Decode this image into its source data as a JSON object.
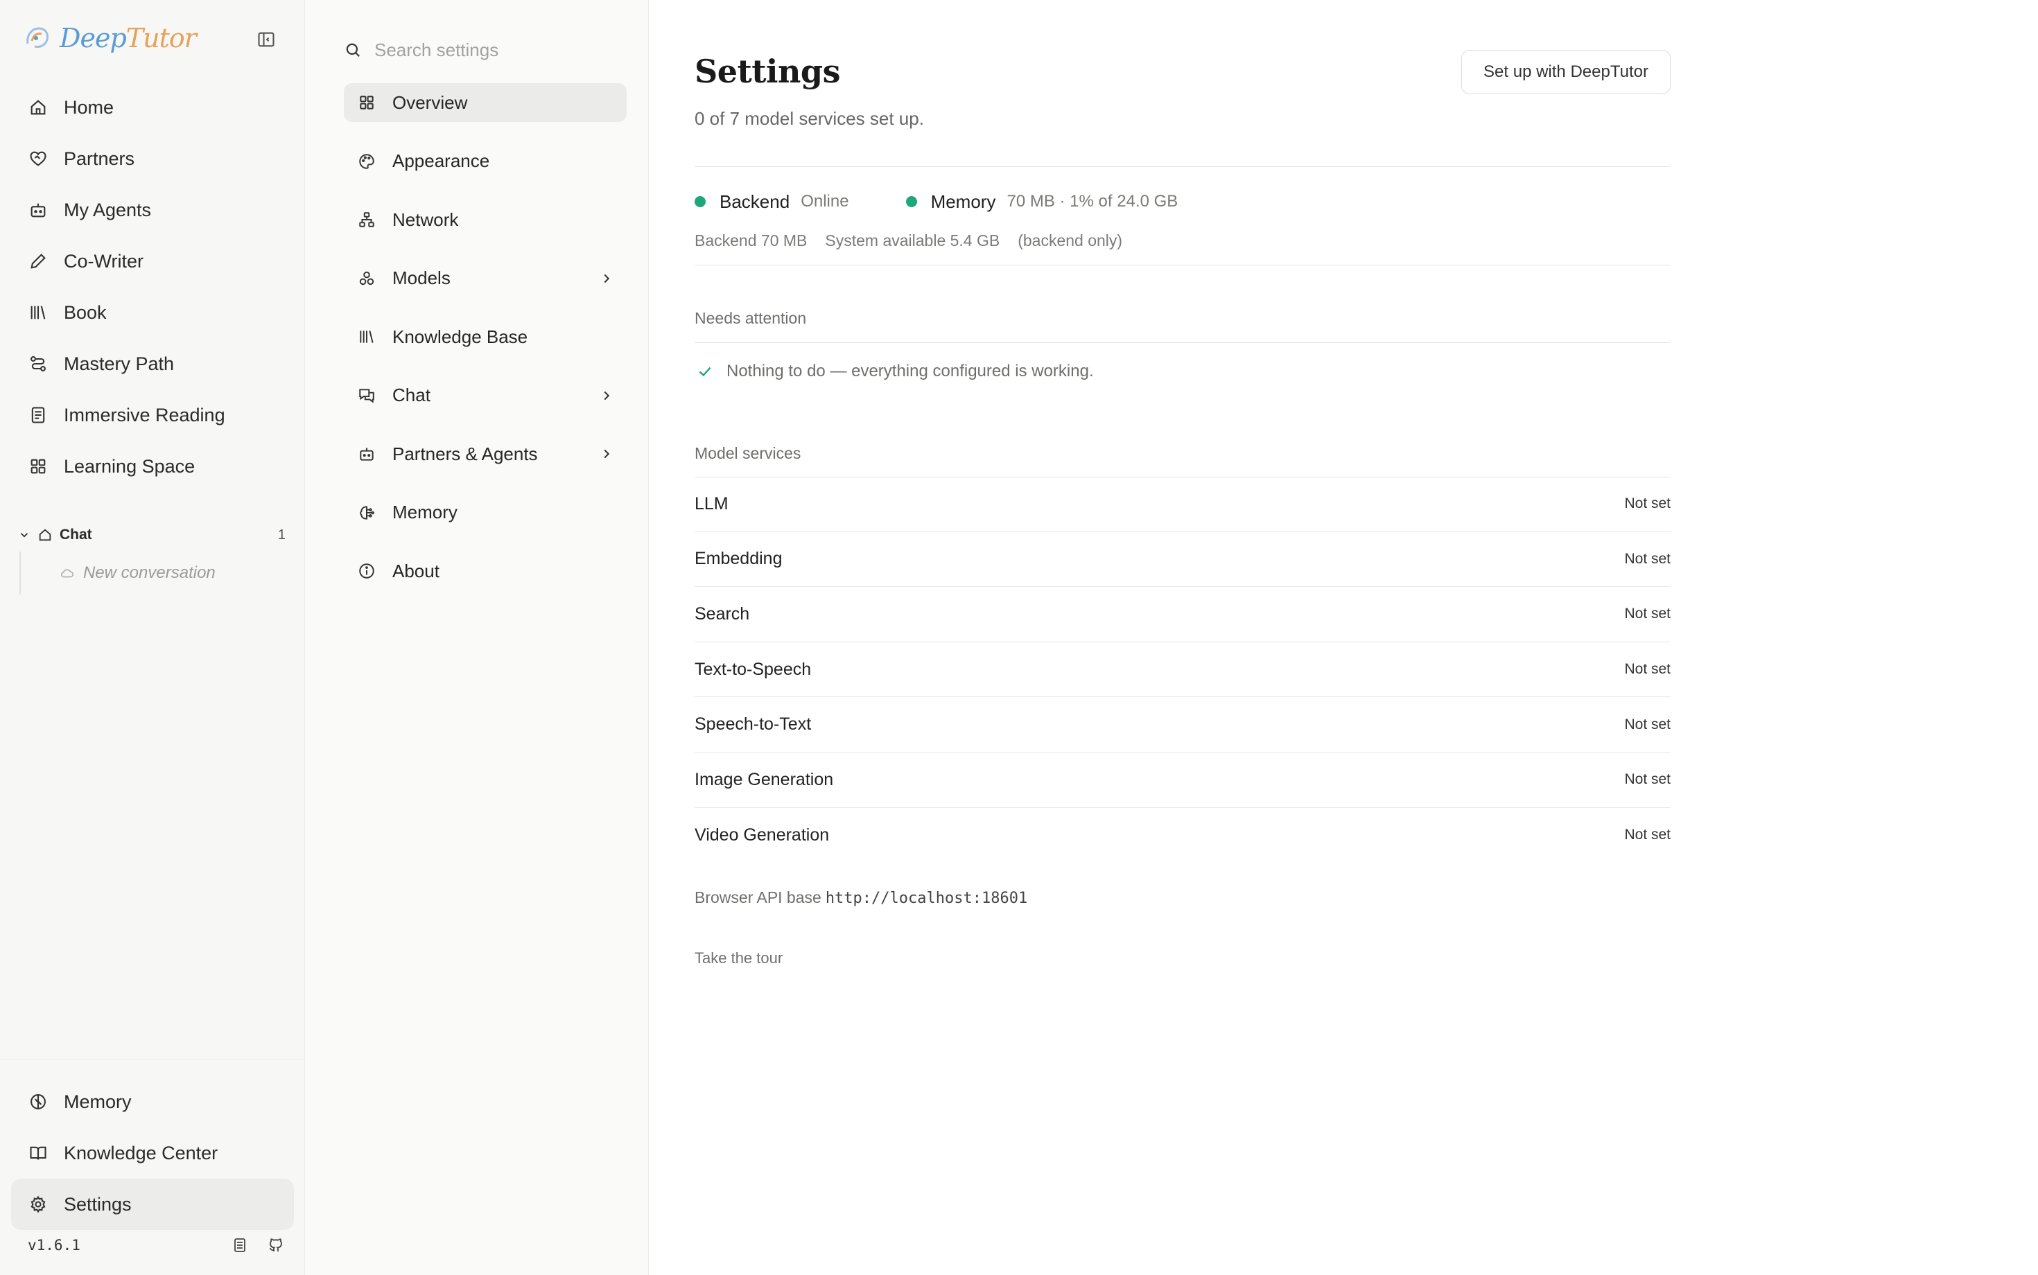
{
  "app": {
    "brand_part1": "Deep",
    "brand_part2": "Tutor",
    "version": "v1.6.1",
    "colors": {
      "brand_blue": "#5b9bd5",
      "brand_orange": "#e8a05a",
      "status_green": "#1fa67a"
    }
  },
  "sidebar": {
    "items": [
      {
        "label": "Home",
        "icon": "home-icon"
      },
      {
        "label": "Partners",
        "icon": "heart-handshake-icon"
      },
      {
        "label": "My Agents",
        "icon": "bot-icon"
      },
      {
        "label": "Co-Writer",
        "icon": "pen-icon"
      },
      {
        "label": "Book",
        "icon": "library-icon"
      },
      {
        "label": "Mastery Path",
        "icon": "route-icon"
      },
      {
        "label": "Immersive Reading",
        "icon": "document-icon"
      },
      {
        "label": "Learning Space",
        "icon": "grid-icon"
      }
    ],
    "chat_group": {
      "label": "Chat",
      "count": "1",
      "child": "New conversation"
    },
    "bottom_items": [
      {
        "label": "Memory",
        "icon": "brain-icon"
      },
      {
        "label": "Knowledge Center",
        "icon": "book-open-icon"
      },
      {
        "label": "Settings",
        "icon": "gear-icon"
      }
    ]
  },
  "subnav": {
    "search_placeholder": "Search settings",
    "items": [
      {
        "label": "Overview",
        "icon": "grid-icon"
      },
      {
        "label": "Appearance",
        "icon": "palette-icon"
      },
      {
        "label": "Network",
        "icon": "network-icon"
      },
      {
        "label": "Models",
        "icon": "boxes-icon"
      },
      {
        "label": "Knowledge Base",
        "icon": "library-icon"
      },
      {
        "label": "Chat",
        "icon": "messages-icon"
      },
      {
        "label": "Partners & Agents",
        "icon": "bot-icon"
      },
      {
        "label": "Memory",
        "icon": "brain-icon"
      },
      {
        "label": "About",
        "icon": "info-icon"
      }
    ]
  },
  "main": {
    "title": "Settings",
    "subtitle": "0 of 7 model services set up.",
    "setup_button": "Set up with DeepTutor",
    "backend": {
      "label": "Backend",
      "status": "Online"
    },
    "memory": {
      "label": "Memory",
      "value": "70 MB · 1% of 24.0 GB"
    },
    "memory_detail": {
      "backend": "Backend 70 MB",
      "system": "System available 5.4 GB",
      "note": "(backend only)"
    },
    "attention": {
      "label": "Needs attention",
      "message": "Nothing to do — everything configured is working."
    },
    "services_label": "Model services",
    "services": [
      {
        "name": "LLM",
        "status": "Not set"
      },
      {
        "name": "Embedding",
        "status": "Not set"
      },
      {
        "name": "Search",
        "status": "Not set"
      },
      {
        "name": "Text-to-Speech",
        "status": "Not set"
      },
      {
        "name": "Speech-to-Text",
        "status": "Not set"
      },
      {
        "name": "Image Generation",
        "status": "Not set"
      },
      {
        "name": "Video Generation",
        "status": "Not set"
      }
    ],
    "api_base_label": "Browser API base",
    "api_base_url": "http://localhost:18601",
    "tour_link": "Take the tour"
  }
}
